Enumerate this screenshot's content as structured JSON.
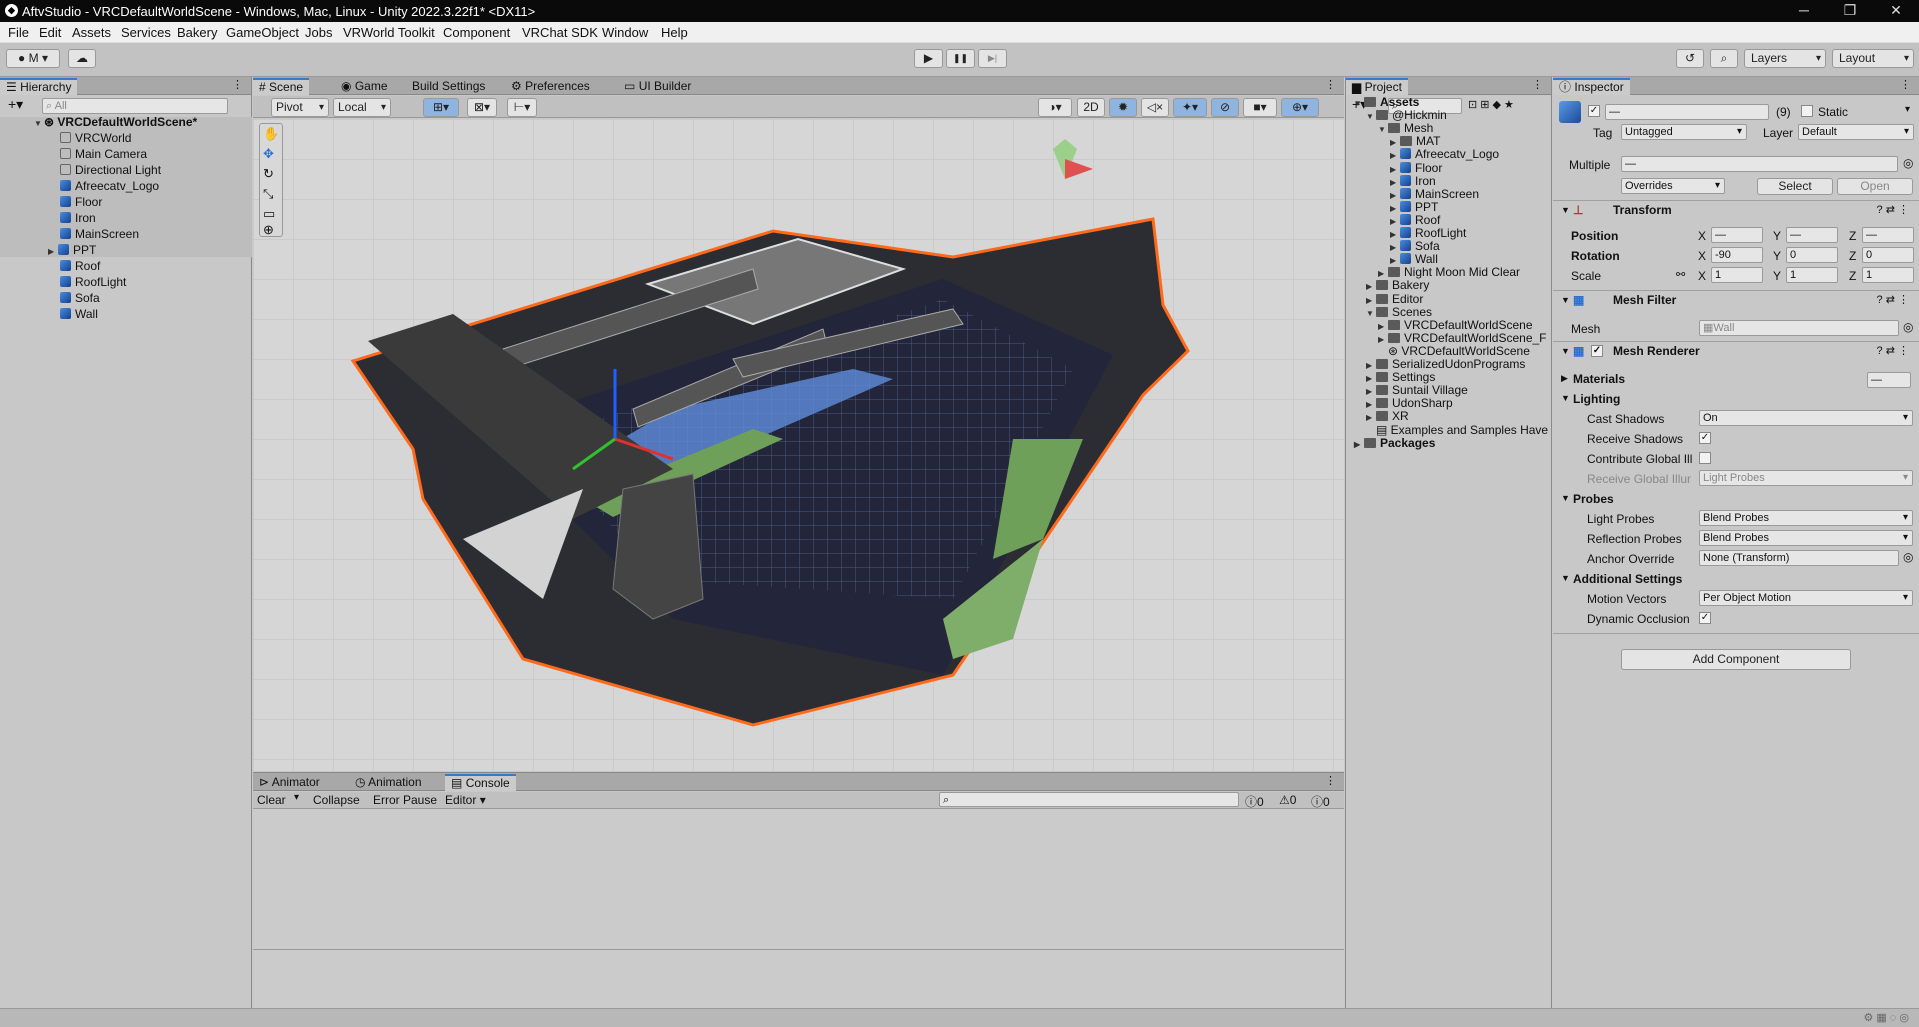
{
  "window": {
    "title": "AftvStudio - VRCDefaultWorldScene - Windows, Mac, Linux - Unity 2022.3.22f1* <DX11>",
    "minimize": "─",
    "maximize": "❐",
    "close": "✕"
  },
  "menu": [
    "File",
    "Edit",
    "Assets",
    "Services",
    "Bakery",
    "GameObject",
    "Jobs",
    "VRWorld Toolkit",
    "Component",
    "VRChat SDK",
    "Window",
    "Help"
  ],
  "toolbar": {
    "account": "M",
    "play": "▶",
    "pause": "❚❚",
    "step": "▶|",
    "layers": "Layers",
    "layout": "Layout"
  },
  "hierarchy": {
    "tab": "Hierarchy",
    "search_placeholder": "All",
    "scene": "VRCDefaultWorldScene*",
    "items": [
      "VRCWorld",
      "Main Camera",
      "Directional Light",
      "Afreecatv_Logo",
      "Floor",
      "Iron",
      "MainScreen",
      "PPT",
      "Roof",
      "RoofLight",
      "Sofa",
      "Wall"
    ]
  },
  "scene_tabs": [
    "Scene",
    "Game",
    "Build Settings",
    "Preferences",
    "UI Builder"
  ],
  "scene_toolbar": {
    "pivot": "Pivot",
    "local": "Local",
    "mode2d": "2D"
  },
  "bottom_tabs": [
    "Animator",
    "Animation",
    "Console"
  ],
  "console": {
    "clear": "Clear",
    "collapse": "Collapse",
    "error_pause": "Error Pause",
    "editor": "Editor",
    "info_count": "0",
    "warn_count": "0",
    "error_count": "0"
  },
  "project": {
    "tab": "Project",
    "tree": [
      {
        "label": "Assets",
        "bold": true,
        "indent": 0
      },
      {
        "label": "@Hickmin",
        "indent": 1
      },
      {
        "label": "Mesh",
        "indent": 2
      },
      {
        "label": "MAT",
        "indent": 3,
        "kind": "folder"
      },
      {
        "label": "Afreecatv_Logo",
        "indent": 3,
        "kind": "mesh"
      },
      {
        "label": "Floor",
        "indent": 3,
        "kind": "mesh"
      },
      {
        "label": "Iron",
        "indent": 3,
        "kind": "mesh"
      },
      {
        "label": "MainScreen",
        "indent": 3,
        "kind": "mesh"
      },
      {
        "label": "PPT",
        "indent": 3,
        "kind": "mesh"
      },
      {
        "label": "Roof",
        "indent": 3,
        "kind": "mesh"
      },
      {
        "label": "RoofLight",
        "indent": 3,
        "kind": "mesh"
      },
      {
        "label": "Sofa",
        "indent": 3,
        "kind": "mesh"
      },
      {
        "label": "Wall",
        "indent": 3,
        "kind": "mesh"
      },
      {
        "label": "Night Moon Mid Clear",
        "indent": 2,
        "kind": "folder"
      },
      {
        "label": "Bakery",
        "indent": 1,
        "kind": "folder"
      },
      {
        "label": "Editor",
        "indent": 1,
        "kind": "folder"
      },
      {
        "label": "Scenes",
        "indent": 1,
        "kind": "folder"
      },
      {
        "label": "VRCDefaultWorldScene",
        "indent": 2,
        "kind": "folder"
      },
      {
        "label": "VRCDefaultWorldScene_F",
        "indent": 2,
        "kind": "folder"
      },
      {
        "label": "VRCDefaultWorldScene",
        "indent": 2,
        "kind": "scene"
      },
      {
        "label": "SerializedUdonPrograms",
        "indent": 1,
        "kind": "folder"
      },
      {
        "label": "Settings",
        "indent": 1,
        "kind": "folder"
      },
      {
        "label": "Suntail Village",
        "indent": 1,
        "kind": "folder"
      },
      {
        "label": "UdonSharp",
        "indent": 1,
        "kind": "folder"
      },
      {
        "label": "XR",
        "indent": 1,
        "kind": "folder"
      },
      {
        "label": "Examples and Samples Have",
        "indent": 1,
        "kind": "file"
      },
      {
        "label": "Packages",
        "bold": true,
        "indent": 0
      }
    ]
  },
  "inspector": {
    "tab": "Inspector",
    "name_value": "—",
    "count": "(9)",
    "static": "Static",
    "tag_label": "Tag",
    "tag_value": "Untagged",
    "layer_label": "Layer",
    "layer_value": "Default",
    "multiple_label": "Multiple",
    "multiple_value": "—",
    "overrides": "Overrides",
    "select": "Select",
    "open": "Open",
    "transform": {
      "title": "Transform",
      "position": {
        "label": "Position",
        "x": "—",
        "y": "—",
        "z": "—"
      },
      "rotation": {
        "label": "Rotation",
        "x": "-90",
        "y": "0",
        "z": "0"
      },
      "scale": {
        "label": "Scale",
        "x": "1",
        "y": "1",
        "z": "1"
      }
    },
    "mesh_filter": {
      "title": "Mesh Filter",
      "mesh_label": "Mesh",
      "mesh_value": "Wall"
    },
    "mesh_renderer": {
      "title": "Mesh Renderer",
      "materials": "Materials",
      "materials_value": "—",
      "lighting": "Lighting",
      "cast_shadows": "Cast Shadows",
      "cast_shadows_value": "On",
      "receive_shadows": "Receive Shadows",
      "contribute_gi": "Contribute Global Ill",
      "receive_gi": "Receive Global Illur",
      "receive_gi_value": "Light Probes",
      "probes": "Probes",
      "light_probes": "Light Probes",
      "light_probes_value": "Blend Probes",
      "reflection_probes": "Reflection Probes",
      "reflection_probes_value": "Blend Probes",
      "anchor_override": "Anchor Override",
      "anchor_override_value": "None (Transform)",
      "additional": "Additional Settings",
      "motion_vectors": "Motion Vectors",
      "motion_vectors_value": "Per Object Motion",
      "dynamic_occlusion": "Dynamic Occlusion"
    },
    "add_component": "Add Component"
  }
}
